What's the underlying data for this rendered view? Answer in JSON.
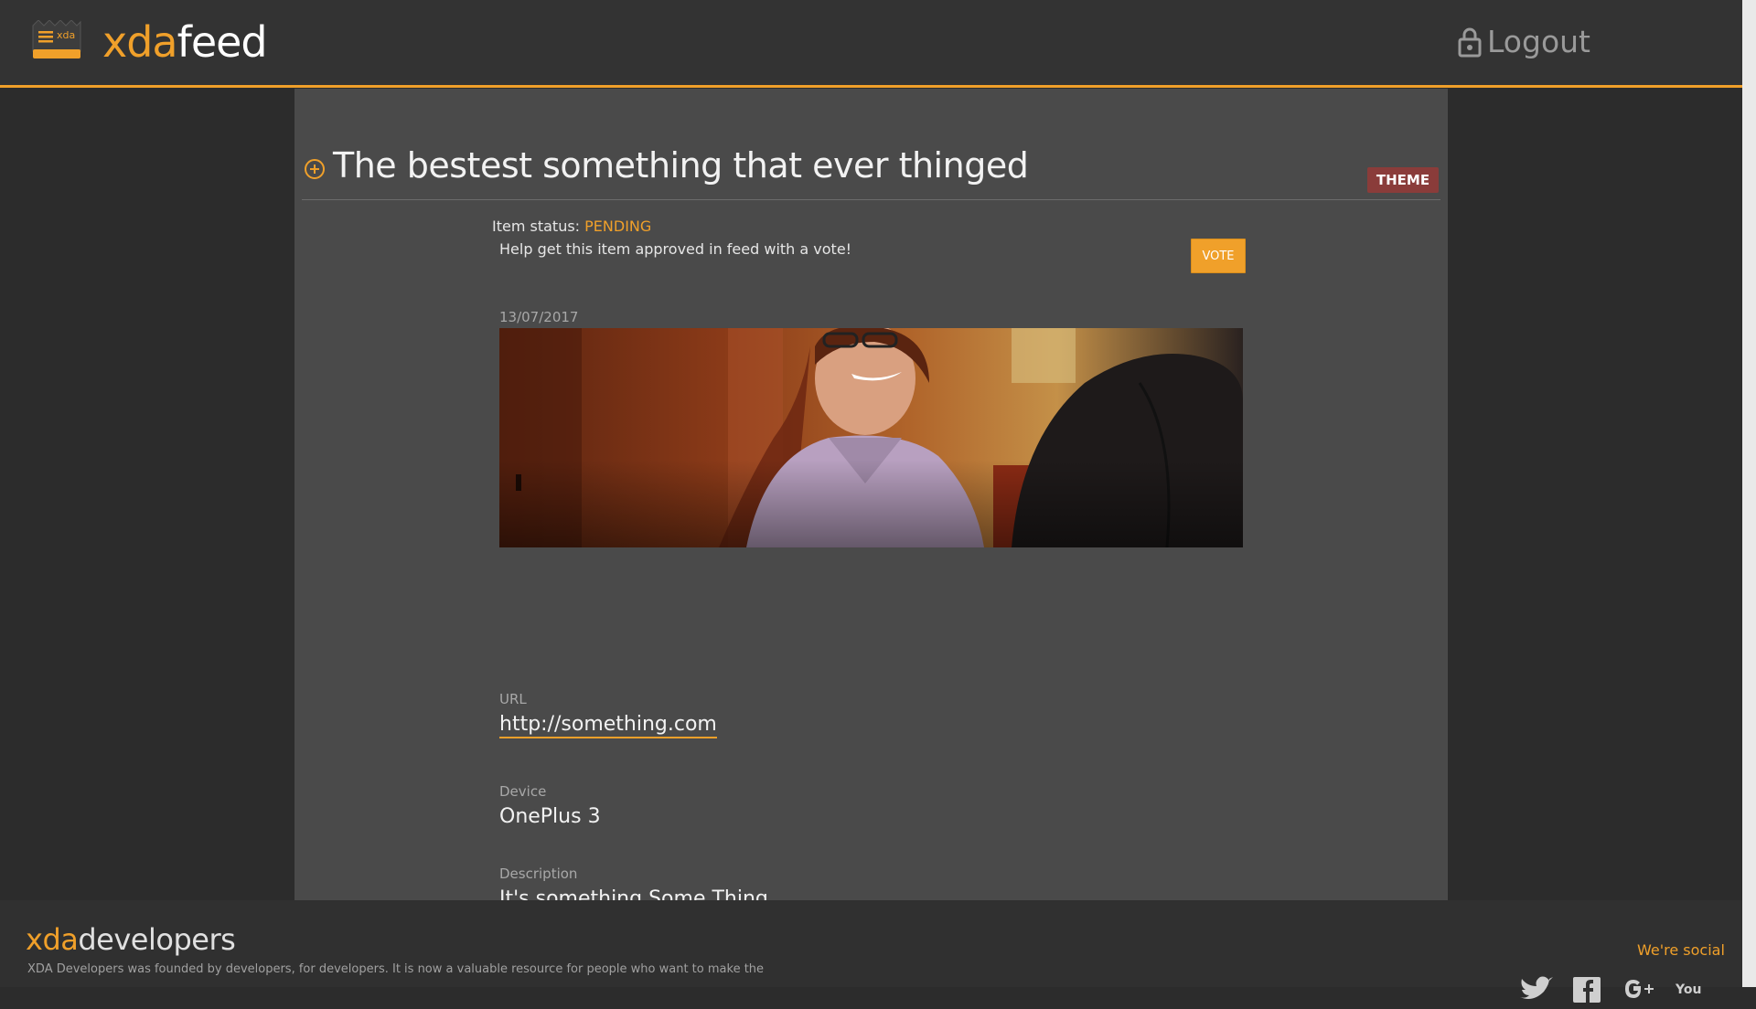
{
  "header": {
    "logo_mark_text": "xda",
    "brand_prefix": "xda",
    "brand_suffix": "feed",
    "logout_label": "Logout"
  },
  "item": {
    "title": "The bestest something that ever thinged",
    "category_badge": "THEME",
    "status_label": "Item status:",
    "status_value": "PENDING",
    "help_text": "Help get this item approved in feed with a vote!",
    "vote_label": "VOTE",
    "date": "13/07/2017",
    "fields": {
      "url_label": "URL",
      "url_value": "http://something.com",
      "device_label": "Device",
      "device_value": "OnePlus 3",
      "description_label": "Description",
      "description_value": "It's something Some Thing."
    }
  },
  "footer": {
    "brand_prefix": "xda",
    "brand_suffix": "developers",
    "description": "XDA Developers was founded by developers, for developers. It is now a valuable resource for people who want to make the",
    "social_title": "We're social",
    "social_icons": [
      "twitter-icon",
      "facebook-icon",
      "google-plus-icon",
      "youtube-icon"
    ]
  },
  "colors": {
    "accent": "#f0a02a",
    "badge": "#8a3c3a",
    "background": "#2c2c2c",
    "card": "#4a4a4a"
  }
}
